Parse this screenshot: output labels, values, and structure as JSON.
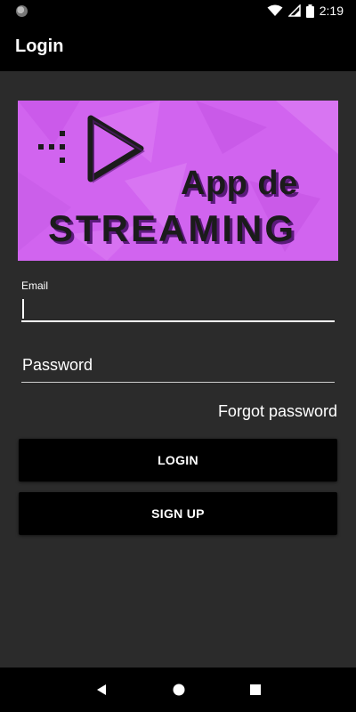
{
  "status_bar": {
    "time": "2:19",
    "icons": [
      "circle-indicator-icon",
      "wifi-icon",
      "signal-icon",
      "battery-icon"
    ]
  },
  "app_bar": {
    "title": "Login"
  },
  "banner": {
    "line1": "App de",
    "line2": "STREAMING",
    "background_color": "#d164ef",
    "icon": "play-logo-icon"
  },
  "form": {
    "email_label": "Email",
    "email_value": "",
    "password_placeholder": "Password",
    "forgot_password": "Forgot password",
    "login_button": "LOGIN",
    "signup_button": "SIGN UP"
  },
  "nav_bar": {
    "icons": [
      "back-icon",
      "home-icon",
      "recents-icon"
    ]
  },
  "colors": {
    "background": "#2b2b2b",
    "bars": "#000000",
    "accent": "#ffffff",
    "button": "#000000"
  }
}
